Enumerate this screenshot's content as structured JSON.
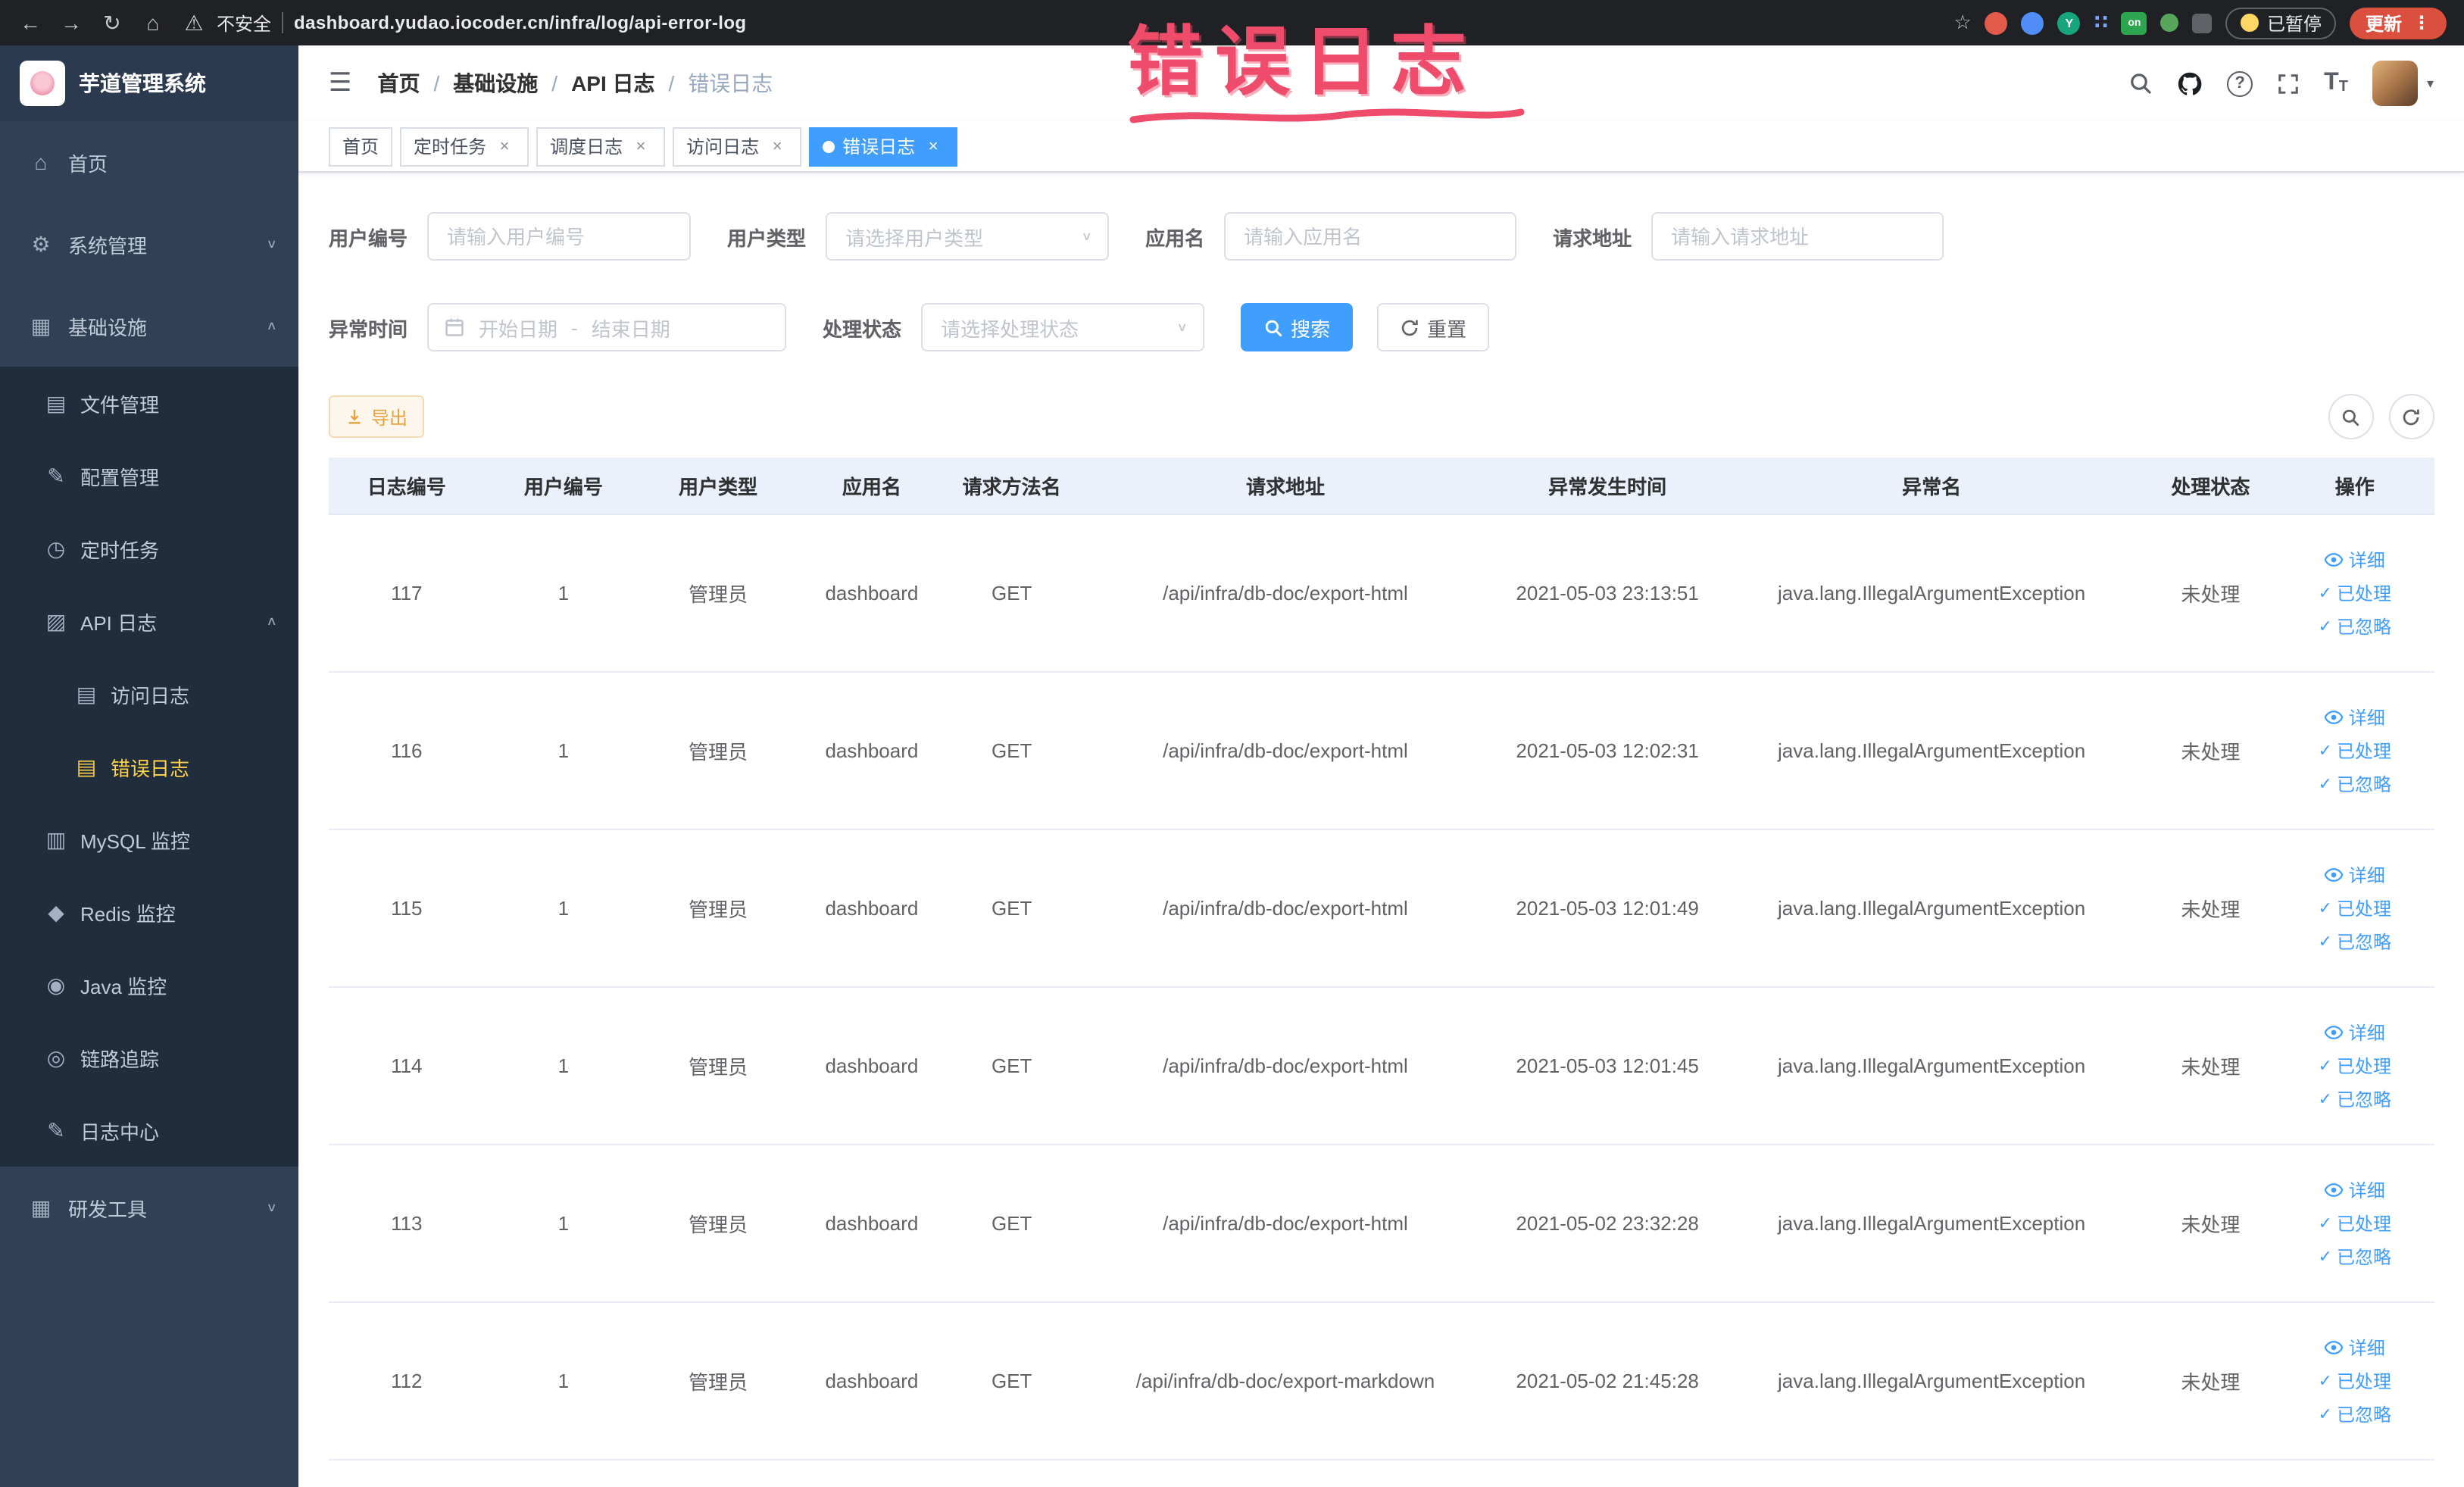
{
  "browser": {
    "security_label": "不安全",
    "url": "dashboard.yudao.iocoder.cn/infra/log/api-error-log",
    "extension_badge": "on",
    "extension_y": "Y",
    "paused_label": "已暂停",
    "update_label": "更新",
    "update_color": "#da4f3e"
  },
  "annotation": {
    "text": "错误日志",
    "color": "#ef4b6a"
  },
  "icons": {
    "back": "←",
    "forward": "→",
    "reload": "↻",
    "home_nav": "⌂",
    "warning": "⚠",
    "star": "☆",
    "grid_dots": "∷",
    "overflow_dots": "⋮",
    "home": "⌂",
    "system": "⚙",
    "infra": "▦",
    "file": "▤",
    "config": "✎",
    "cron": "◷",
    "api_log": "▨",
    "doc": "▤",
    "mysql": "▥",
    "redis": "◆",
    "java": "◉",
    "trace": "◎",
    "log_center": "✎",
    "arrow_up": "∧",
    "arrow_down": "∨",
    "hamburger": "☰",
    "close": "×",
    "check": "✓",
    "caret": "▾",
    "help": "?",
    "font_big": "T",
    "font_small": "T"
  },
  "sidebar": {
    "logo_title": "芋道管理系统",
    "items": {
      "home": "首页",
      "system": "系统管理",
      "infra": "基础设施",
      "file_mgmt": "文件管理",
      "config_mgmt": "配置管理",
      "cron_job": "定时任务",
      "api_log": "API 日志",
      "access_log": "访问日志",
      "error_log": "错误日志",
      "mysql": "MySQL 监控",
      "redis": "Redis 监控",
      "java": "Java 监控",
      "tracing": "链路追踪",
      "log_center": "日志中心",
      "dev_tools": "研发工具"
    }
  },
  "header": {
    "breadcrumbs": [
      "首页",
      "基础设施",
      "API 日志",
      "错误日志"
    ],
    "separator": "/"
  },
  "tabs": [
    {
      "label": "首页"
    },
    {
      "label": "定时任务"
    },
    {
      "label": "调度日志"
    },
    {
      "label": "访问日志"
    },
    {
      "label": "错误日志"
    }
  ],
  "filters": {
    "user_id": {
      "label": "用户编号",
      "placeholder": "请输入用户编号",
      "value": ""
    },
    "user_type": {
      "label": "用户类型",
      "placeholder": "请选择用户类型"
    },
    "app_name": {
      "label": "应用名",
      "placeholder": "请输入应用名",
      "value": ""
    },
    "request_url": {
      "label": "请求地址",
      "placeholder": "请输入请求地址",
      "value": ""
    },
    "exception_time": {
      "label": "异常时间",
      "start_placeholder": "开始日期",
      "separator": "-",
      "end_placeholder": "结束日期"
    },
    "process_status": {
      "label": "处理状态",
      "placeholder": "请选择处理状态"
    },
    "search_label": "搜索",
    "reset_label": "重置"
  },
  "toolbar": {
    "export_label": "导出"
  },
  "table": {
    "columns": [
      "日志编号",
      "用户编号",
      "用户类型",
      "应用名",
      "请求方法名",
      "请求地址",
      "异常发生时间",
      "异常名",
      "处理状态",
      "操作"
    ],
    "actions": {
      "detail": "详细",
      "processed": "已处理",
      "ignored": "已忽略"
    },
    "rows": [
      {
        "id": "117",
        "user_id": "1",
        "user_type": "管理员",
        "app": "dashboard",
        "method": "GET",
        "url": "/api/infra/db-doc/export-html",
        "time": "2021-05-03 23:13:51",
        "exception": "java.lang.IllegalArgumentException",
        "status": "未处理"
      },
      {
        "id": "116",
        "user_id": "1",
        "user_type": "管理员",
        "app": "dashboard",
        "method": "GET",
        "url": "/api/infra/db-doc/export-html",
        "time": "2021-05-03 12:02:31",
        "exception": "java.lang.IllegalArgumentException",
        "status": "未处理"
      },
      {
        "id": "115",
        "user_id": "1",
        "user_type": "管理员",
        "app": "dashboard",
        "method": "GET",
        "url": "/api/infra/db-doc/export-html",
        "time": "2021-05-03 12:01:49",
        "exception": "java.lang.IllegalArgumentException",
        "status": "未处理"
      },
      {
        "id": "114",
        "user_id": "1",
        "user_type": "管理员",
        "app": "dashboard",
        "method": "GET",
        "url": "/api/infra/db-doc/export-html",
        "time": "2021-05-03 12:01:45",
        "exception": "java.lang.IllegalArgumentException",
        "status": "未处理"
      },
      {
        "id": "113",
        "user_id": "1",
        "user_type": "管理员",
        "app": "dashboard",
        "method": "GET",
        "url": "/api/infra/db-doc/export-html",
        "time": "2021-05-02 23:32:28",
        "exception": "java.lang.IllegalArgumentException",
        "status": "未处理"
      },
      {
        "id": "112",
        "user_id": "1",
        "user_type": "管理员",
        "app": "dashboard",
        "method": "GET",
        "url": "/api/infra/db-doc/export-markdown",
        "time": "2021-05-02 21:45:28",
        "exception": "java.lang.IllegalArgumentException",
        "status": "未处理"
      }
    ]
  }
}
